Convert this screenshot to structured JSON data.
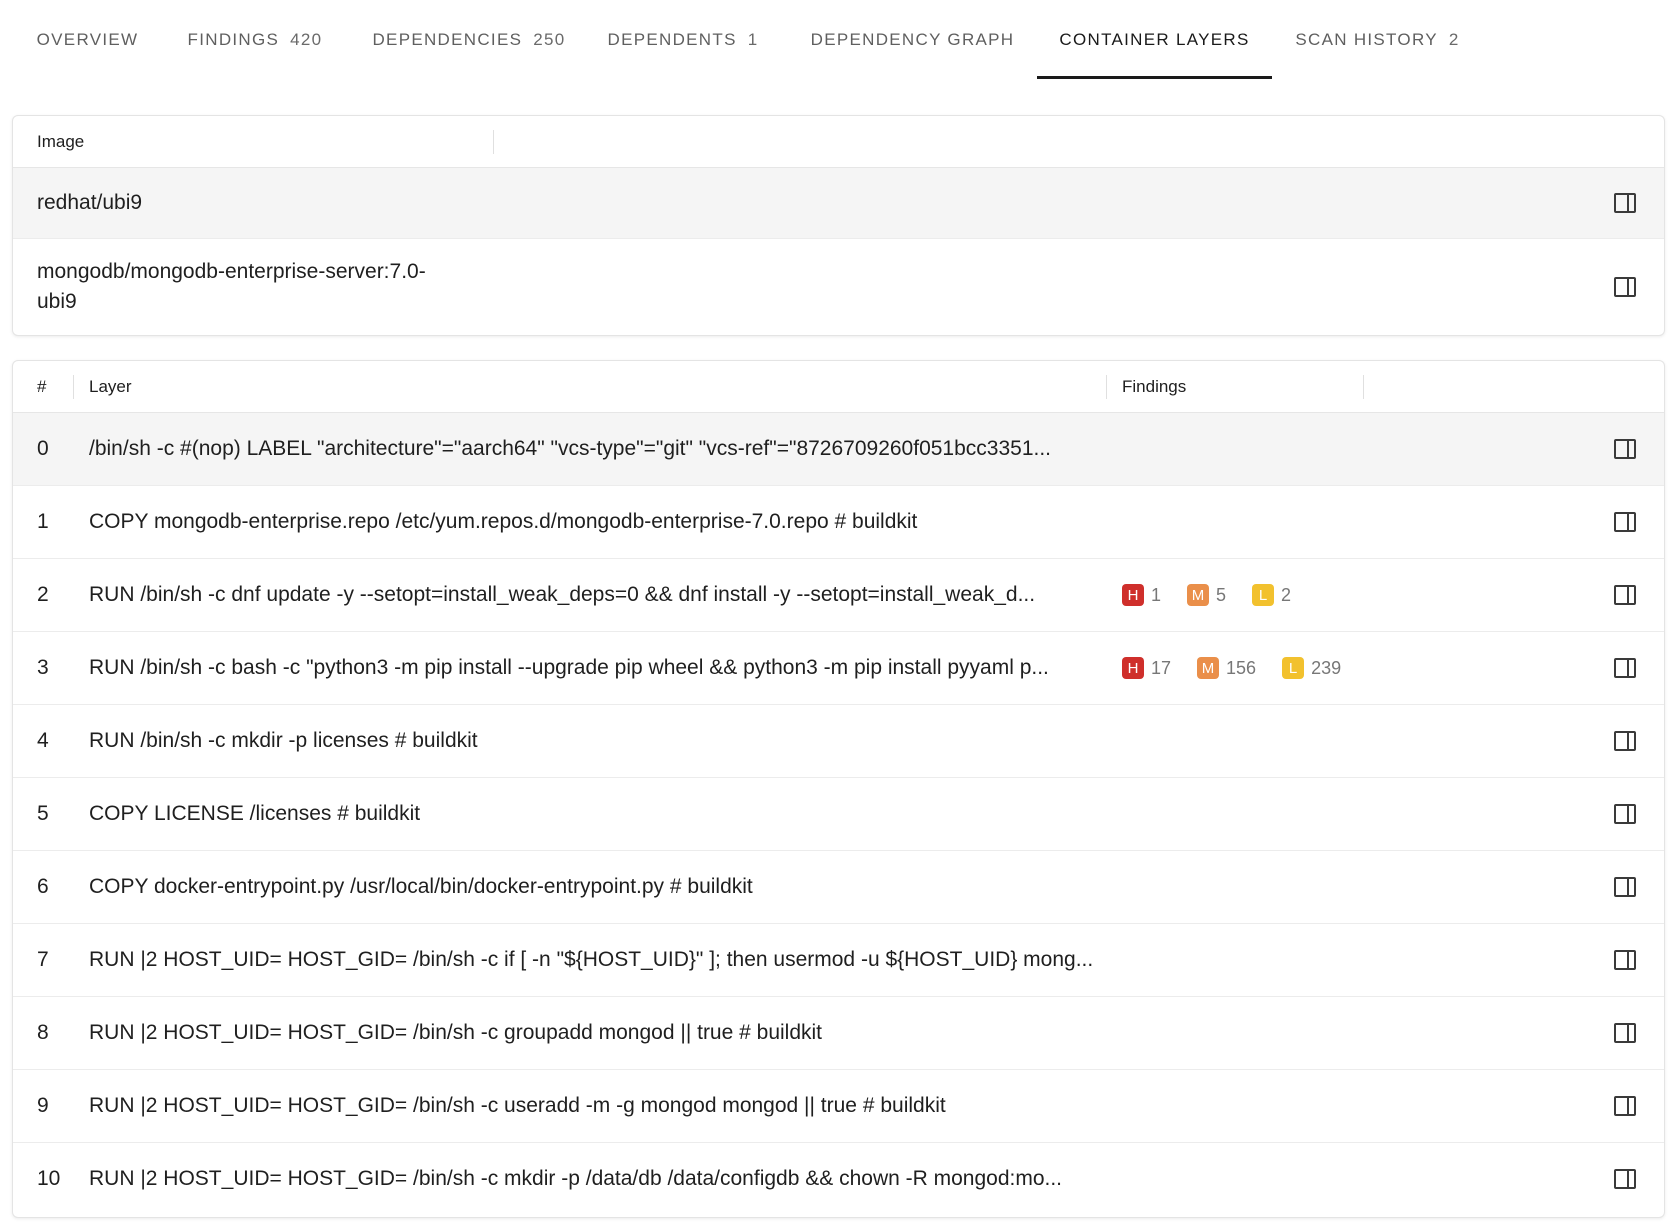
{
  "tabs": [
    {
      "label": "OVERVIEW",
      "count": "",
      "active": false
    },
    {
      "label": "FINDINGS",
      "count": "420",
      "active": false
    },
    {
      "label": "DEPENDENCIES",
      "count": "250",
      "active": false
    },
    {
      "label": "DEPENDENTS",
      "count": "1",
      "active": false
    },
    {
      "label": "DEPENDENCY GRAPH",
      "count": "",
      "active": false
    },
    {
      "label": "CONTAINER LAYERS",
      "count": "",
      "active": true
    },
    {
      "label": "SCAN HISTORY",
      "count": "2",
      "active": false
    }
  ],
  "images": {
    "header": "Image",
    "rows": [
      {
        "name": "redhat/ubi9",
        "selected": true
      },
      {
        "name": "mongodb/mongodb-enterprise-server:7.0-ubi9",
        "selected": false
      }
    ]
  },
  "layers": {
    "headers": {
      "index": "#",
      "layer": "Layer",
      "findings": "Findings"
    },
    "rows": [
      {
        "index": "0",
        "command": "/bin/sh -c #(nop) LABEL \"architecture\"=\"aarch64\" \"vcs-type\"=\"git\" \"vcs-ref\"=\"8726709260f051bcc3351...",
        "findings": [],
        "selected": true
      },
      {
        "index": "1",
        "command": "COPY mongodb-enterprise.repo /etc/yum.repos.d/mongodb-enterprise-7.0.repo # buildkit",
        "findings": []
      },
      {
        "index": "2",
        "command": "RUN /bin/sh -c dnf update -y --setopt=install_weak_deps=0 && dnf install -y --setopt=install_weak_d...",
        "findings": [
          {
            "sev": "H",
            "count": "1",
            "color": "#cf2f2b"
          },
          {
            "sev": "M",
            "count": "5",
            "color": "#ea8f4a"
          },
          {
            "sev": "L",
            "count": "2",
            "color": "#f2c12e"
          }
        ]
      },
      {
        "index": "3",
        "command": "RUN /bin/sh -c bash -c \"python3 -m pip install --upgrade pip wheel && python3 -m pip install pyyaml p...",
        "findings": [
          {
            "sev": "H",
            "count": "17",
            "color": "#cf2f2b"
          },
          {
            "sev": "M",
            "count": "156",
            "color": "#ea8f4a"
          },
          {
            "sev": "L",
            "count": "239",
            "color": "#f2c12e"
          }
        ]
      },
      {
        "index": "4",
        "command": "RUN /bin/sh -c mkdir -p licenses # buildkit",
        "findings": []
      },
      {
        "index": "5",
        "command": "COPY LICENSE /licenses # buildkit",
        "findings": []
      },
      {
        "index": "6",
        "command": "COPY docker-entrypoint.py /usr/local/bin/docker-entrypoint.py # buildkit",
        "findings": []
      },
      {
        "index": "7",
        "command": "RUN |2 HOST_UID= HOST_GID= /bin/sh -c if [ -n \"${HOST_UID}\" ]; then usermod -u ${HOST_UID} mong...",
        "findings": []
      },
      {
        "index": "8",
        "command": "RUN |2 HOST_UID= HOST_GID= /bin/sh -c groupadd mongod || true # buildkit",
        "findings": []
      },
      {
        "index": "9",
        "command": "RUN |2 HOST_UID= HOST_GID= /bin/sh -c useradd -m -g mongod mongod || true # buildkit",
        "findings": []
      },
      {
        "index": "10",
        "command": "RUN |2 HOST_UID= HOST_GID= /bin/sh -c mkdir -p /data/db /data/configdb && chown -R mongod:mo...",
        "findings": []
      }
    ]
  },
  "icons": {
    "row_action": "panel-right-icon"
  }
}
